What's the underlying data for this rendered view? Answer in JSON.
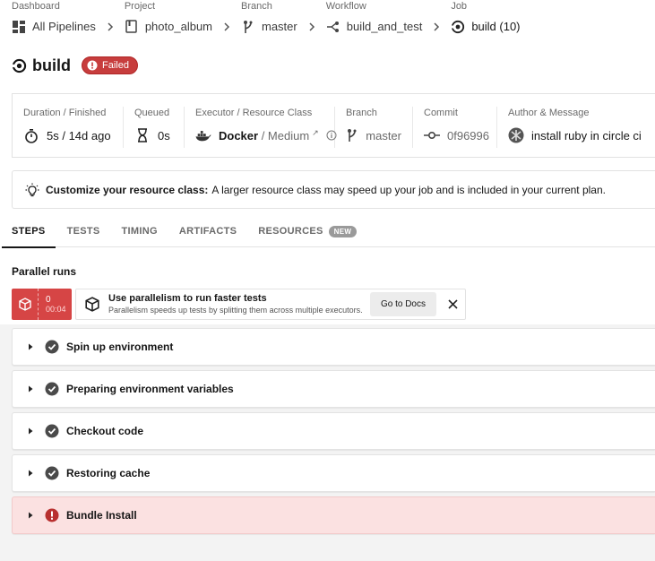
{
  "breadcrumb": [
    {
      "label": "Dashboard",
      "value": "All Pipelines",
      "icon": "dashboard-icon"
    },
    {
      "label": "Project",
      "value": "photo_album",
      "icon": "project-icon"
    },
    {
      "label": "Branch",
      "value": "master",
      "icon": "branch-icon"
    },
    {
      "label": "Workflow",
      "value": "build_and_test",
      "icon": "workflow-icon"
    },
    {
      "label": "Job",
      "value": "build (10)",
      "icon": "job-icon"
    }
  ],
  "job": {
    "title": "build",
    "status": "Failed"
  },
  "info": {
    "duration": {
      "label": "Duration / Finished",
      "value": "5s / 14d ago"
    },
    "queued": {
      "label": "Queued",
      "value": "0s"
    },
    "executor": {
      "label": "Executor / Resource Class",
      "name": "Docker",
      "separator": " / ",
      "class": "Medium",
      "ext": "↗"
    },
    "branch": {
      "label": "Branch",
      "value": "master"
    },
    "commit": {
      "label": "Commit",
      "value": "0f96996"
    },
    "author": {
      "label": "Author & Message",
      "value": "install ruby in circle ci"
    }
  },
  "tip": {
    "bold": "Customize your resource class:",
    "text": "A larger resource class may speed up your job and is included in your current plan."
  },
  "tabs": [
    {
      "label": "STEPS",
      "active": true
    },
    {
      "label": "TESTS"
    },
    {
      "label": "TIMING"
    },
    {
      "label": "ARTIFACTS"
    },
    {
      "label": "RESOURCES",
      "badge": "NEW"
    }
  ],
  "parallel": {
    "title": "Parallel runs",
    "run_index": "0",
    "run_time": "00:04",
    "tip_heading": "Use parallelism to run faster tests",
    "tip_text": "Parallelism speeds up tests by splitting them across multiple executors.",
    "docs_button": "Go to Docs",
    "close": "✕"
  },
  "steps": [
    {
      "label": "Spin up environment",
      "status": "success"
    },
    {
      "label": "Preparing environment variables",
      "status": "success"
    },
    {
      "label": "Checkout code",
      "status": "success"
    },
    {
      "label": "Restoring cache",
      "status": "success"
    },
    {
      "label": "Bundle Install",
      "status": "failed"
    }
  ],
  "colors": {
    "failed": "#c73d3d",
    "failed_row": "#fbe1e1",
    "success_icon": "#4a4a4a"
  }
}
